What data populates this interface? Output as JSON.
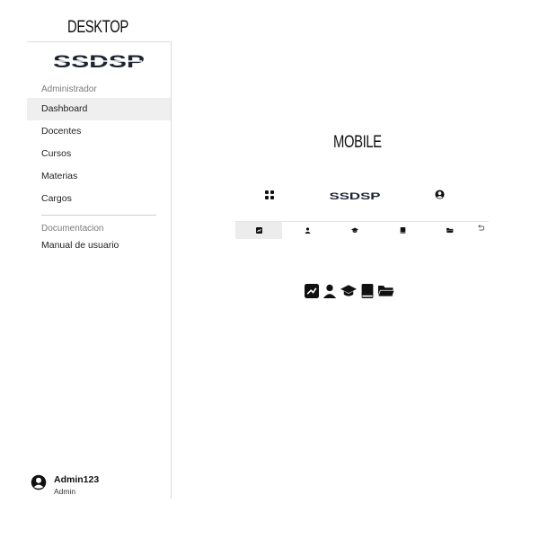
{
  "desktop_section": {
    "title": "DESKTOP"
  },
  "mobile_section": {
    "title": "MOBILE"
  },
  "sidebar": {
    "brand": "SSDSP",
    "group_admin": "Administrador",
    "items": [
      {
        "label": "Dashboard",
        "active": true
      },
      {
        "label": "Docentes"
      },
      {
        "label": "Cursos"
      },
      {
        "label": "Materias"
      },
      {
        "label": "Cargos"
      }
    ],
    "group_docs": "Documentacion",
    "docs_items": [
      {
        "label": "Manual de usuario"
      }
    ],
    "user": {
      "name": "Admin123",
      "role": "Admin"
    }
  },
  "mobile": {
    "brand": "SSDSP",
    "header_icons": [
      "grid-icon",
      "account-circle-icon"
    ],
    "tabs": [
      {
        "icon": "chart-icon",
        "active": true
      },
      {
        "icon": "person-icon"
      },
      {
        "icon": "graduation-cap-icon"
      },
      {
        "icon": "book-icon"
      },
      {
        "icon": "folder-icon"
      }
    ],
    "back_icon": "back-arrow-icon",
    "legend_icons": [
      "chart-icon",
      "person-icon",
      "graduation-cap-icon",
      "book-icon",
      "folder-icon"
    ]
  }
}
